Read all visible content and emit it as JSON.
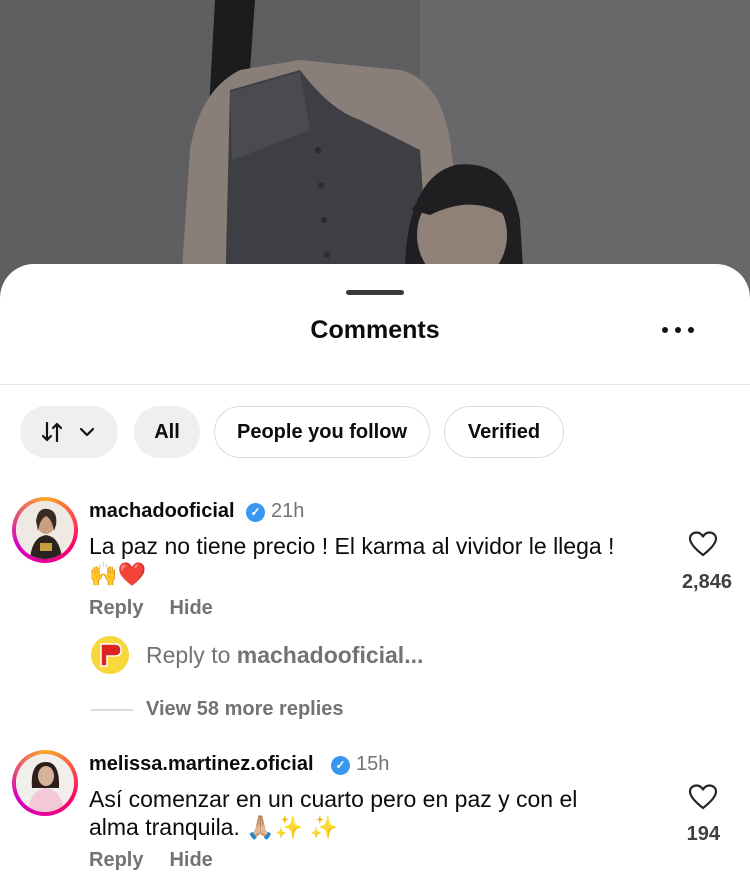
{
  "sheet": {
    "title": "Comments",
    "more_icon": "more-horizontal-icon"
  },
  "filters": {
    "sort_icon": "sort-arrows-icon",
    "chips": [
      "All",
      "People you follow",
      "Verified"
    ]
  },
  "comments": [
    {
      "username": "machadooficial",
      "verified": true,
      "time": "21h",
      "text_line1": "La paz no tiene precio ! El karma al vividor le llega !",
      "text_line2": "🙌❤️",
      "likes": "2,846",
      "actions": {
        "reply": "Reply",
        "hide": "Hide"
      },
      "reply_prompt": {
        "prefix": "Reply to ",
        "target": "machadooficial..."
      },
      "view_more": "View 58 more replies"
    },
    {
      "username": "melissa.martinez.oficial",
      "verified": true,
      "time": "15h",
      "text_line1": "Así comenzar en un cuarto pero en paz y con el",
      "text_line2": "alma tranquila. 🙏🏼✨ ✨",
      "likes": "194",
      "actions": {
        "reply": "Reply",
        "hide": "Hide"
      }
    }
  ]
}
